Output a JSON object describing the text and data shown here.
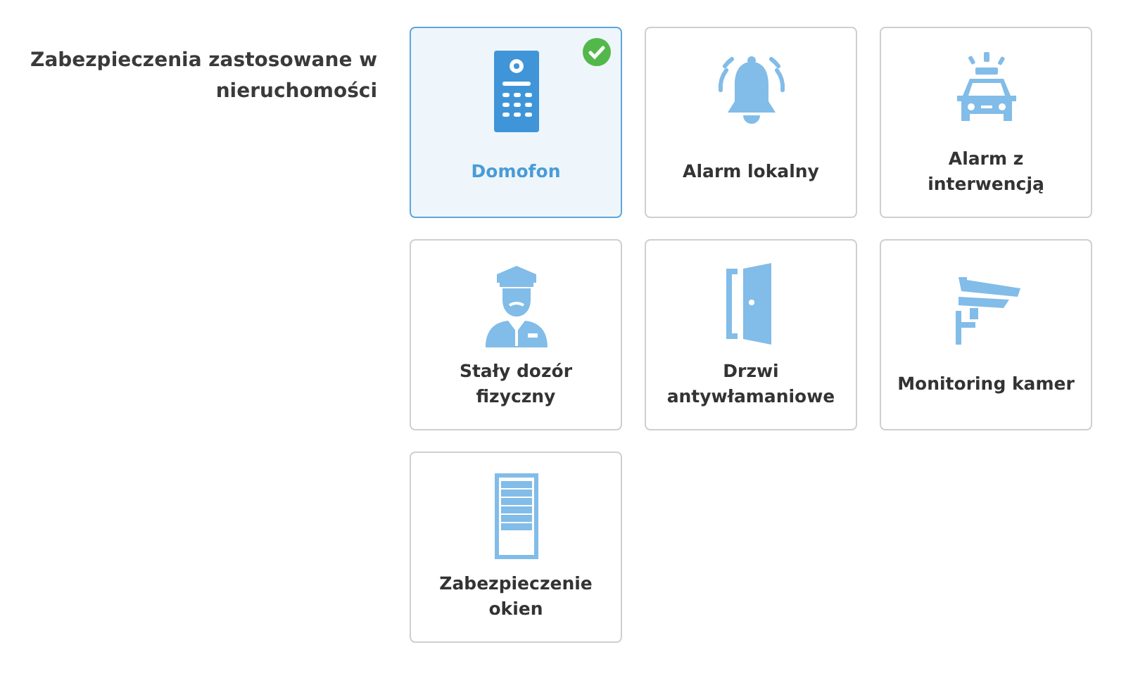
{
  "section": {
    "label": "Zabezpieczenia zastosowane w nieruchomości"
  },
  "options": [
    {
      "kind": "intercom",
      "label": "Domofon",
      "selected": true
    },
    {
      "kind": "bell",
      "label": "Alarm lokalny",
      "selected": false
    },
    {
      "kind": "car",
      "label": "Alarm z interwencją",
      "selected": false
    },
    {
      "kind": "guard",
      "label": "Stały dozór fizyczny",
      "selected": false
    },
    {
      "kind": "door",
      "label": "Drzwi antywłamaniowe",
      "selected": false
    },
    {
      "kind": "camera",
      "label": "Monitoring kamer",
      "selected": false
    },
    {
      "kind": "window",
      "label": "Zabezpieczenie okien",
      "selected": false
    }
  ]
}
